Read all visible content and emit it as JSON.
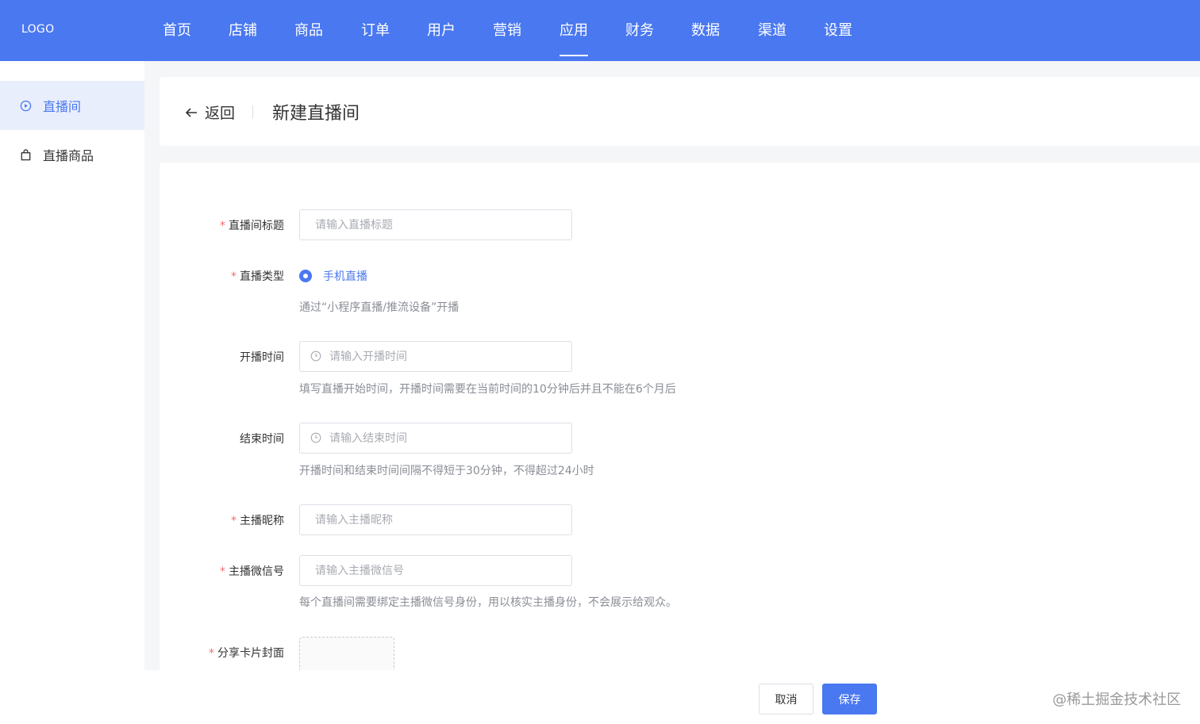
{
  "brand": {
    "logo": "LOGO"
  },
  "nav": {
    "items": [
      "首页",
      "店铺",
      "商品",
      "订单",
      "用户",
      "营销",
      "应用",
      "财务",
      "数据",
      "渠道",
      "设置"
    ],
    "active": "应用"
  },
  "sidebar": {
    "items": [
      {
        "label": "直播间",
        "icon": "play-circle-icon",
        "active": true
      },
      {
        "label": "直播商品",
        "icon": "shopping-bag-icon",
        "active": false
      }
    ]
  },
  "header": {
    "back_label": "返回",
    "title": "新建直播间"
  },
  "form": {
    "room_title": {
      "label": "直播间标题",
      "required": true,
      "value": "",
      "placeholder": "请输入直播标题"
    },
    "live_type": {
      "label": "直播类型",
      "required": true,
      "selected_option": "手机直播",
      "hint": "通过“小程序直播/推流设备”开播"
    },
    "start_time": {
      "label": "开播时间",
      "required": false,
      "value": "",
      "placeholder": "请输入开播时间",
      "hint": "填写直播开始时间，开播时间需要在当前时间的10分钟后并且不能在6个月后"
    },
    "end_time": {
      "label": "结束时间",
      "required": false,
      "value": "",
      "placeholder": "请输入结束时间",
      "hint": "开播时间和结束时间间隔不得短于30分钟，不得超过24小时"
    },
    "host_nickname": {
      "label": "主播昵称",
      "required": true,
      "value": "",
      "placeholder": "请输入主播昵称"
    },
    "host_wechat": {
      "label": "主播微信号",
      "required": true,
      "value": "",
      "placeholder": "请输入主播微信号",
      "hint": "每个直播间需要绑定主播微信号身份，用以核实主播身份，不会展示给观众。"
    },
    "share_cover": {
      "label": "分享卡片封面",
      "required": true
    }
  },
  "footer": {
    "cancel_label": "取消",
    "save_label": "保存"
  },
  "watermark": "@稀土掘金技术社区",
  "colors": {
    "primary": "#4a78f0",
    "required": "#f56c6c",
    "hint": "#8a8e96",
    "page_bg": "#f5f6f8"
  }
}
